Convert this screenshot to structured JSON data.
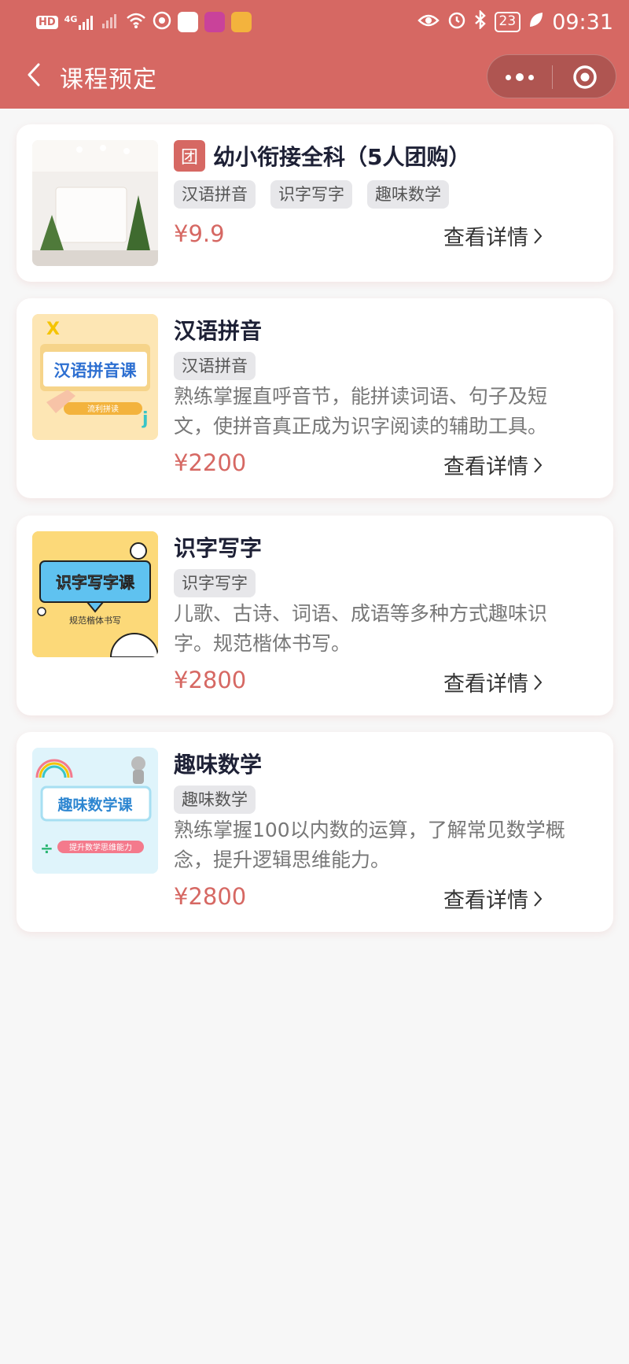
{
  "status_bar": {
    "hd": "HD",
    "signal": "4G",
    "battery": "23",
    "time": "09:31"
  },
  "nav": {
    "title": "课程预定"
  },
  "courses": [
    {
      "badge": "团",
      "title": "幼小衔接全科（5人团购）",
      "tags": [
        "汉语拼音",
        "识字写字",
        "趣味数学"
      ],
      "description": "",
      "price": "¥9.9",
      "detail_label": "查看详情"
    },
    {
      "title": "汉语拼音",
      "tags": [
        "汉语拼音"
      ],
      "description": "熟练掌握直呼音节，能拼读词语、句子及短文，使拼音真正成为识字阅读的辅助工具。",
      "price": "¥2200",
      "detail_label": "查看详情",
      "thumb_text": "汉语拼音课",
      "thumb_sub": "流利拼读"
    },
    {
      "title": "识字写字",
      "tags": [
        "识字写字"
      ],
      "description": "儿歌、古诗、词语、成语等多种方式趣味识字。规范楷体书写。",
      "price": "¥2800",
      "detail_label": "查看详情",
      "thumb_text": "识字写字课",
      "thumb_sub": "规范楷体书写"
    },
    {
      "title": "趣味数学",
      "tags": [
        "趣味数学"
      ],
      "description": "熟练掌握100以内数的运算，了解常见数学概念，提升逻辑思维能力。",
      "price": "¥2800",
      "detail_label": "查看详情",
      "thumb_text": "趣味数学课",
      "thumb_sub": "提升数学思维能力"
    }
  ],
  "colors": {
    "brand": "#d66863",
    "background": "#f7f7f7"
  }
}
